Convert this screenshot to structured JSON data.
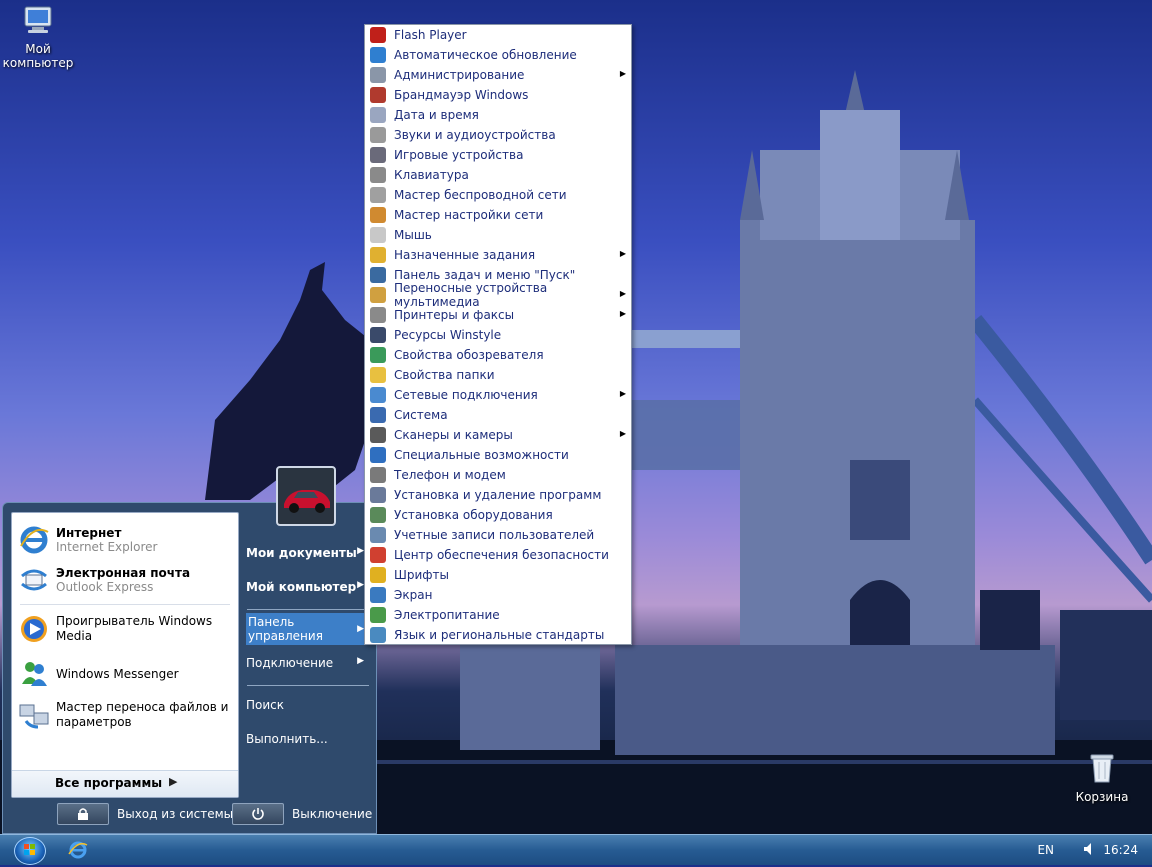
{
  "desktop": {
    "icons": [
      {
        "label_line1": "Мой",
        "label_line2": "компьютер",
        "icon": "my-computer-icon"
      },
      {
        "label_line1": "Корзина",
        "icon": "recycle-bin-icon"
      }
    ]
  },
  "start_menu": {
    "pinned": [
      {
        "title": "Интернет",
        "subtitle": "Internet Explorer",
        "icon": "internet-explorer-icon"
      },
      {
        "title": "Электронная почта",
        "subtitle": "Outlook Express",
        "icon": "outlook-express-icon"
      }
    ],
    "recent": [
      {
        "line1": "Проигрыватель Windows",
        "line2": "Media",
        "icon": "windows-media-player-icon"
      },
      {
        "line1": "Windows Messenger",
        "icon": "windows-messenger-icon"
      },
      {
        "line1": "Мастер переноса файлов и",
        "line2": "параметров",
        "icon": "files-transfer-wizard-icon"
      }
    ],
    "all_programs": "Все программы",
    "right": {
      "my_documents": "Мои документы",
      "my_computer": "Мой компьютер",
      "control_panel_line1": "Панель",
      "control_panel_line2": "управления",
      "connect": "Подключение",
      "search": "Поиск",
      "run": "Выполнить..."
    },
    "logoff": "Выход из системы",
    "shutdown": "Выключение"
  },
  "control_panel_menu": {
    "items": [
      {
        "label": "Flash Player",
        "submenu": false,
        "color": "#c0201a"
      },
      {
        "label": "Автоматическое обновление",
        "submenu": false,
        "color": "#2f7fd0"
      },
      {
        "label": "Администрирование",
        "submenu": true,
        "color": "#8a96a8"
      },
      {
        "label": "Брандмауэр Windows",
        "submenu": false,
        "color": "#b03a2e"
      },
      {
        "label": "Дата и время",
        "submenu": false,
        "color": "#9aa6c0"
      },
      {
        "label": "Звуки и аудиоустройства",
        "submenu": false,
        "color": "#9a9a9a"
      },
      {
        "label": "Игровые устройства",
        "submenu": false,
        "color": "#6a6a7a"
      },
      {
        "label": "Клавиатура",
        "submenu": false,
        "color": "#8a8a8a"
      },
      {
        "label": "Мастер беспроводной сети",
        "submenu": false,
        "color": "#a0a0a0"
      },
      {
        "label": "Мастер настройки сети",
        "submenu": false,
        "color": "#d08a30"
      },
      {
        "label": "Мышь",
        "submenu": false,
        "color": "#c8c8c8"
      },
      {
        "label": "Назначенные задания",
        "submenu": true,
        "color": "#e0b030"
      },
      {
        "label": "Панель задач и меню \"Пуск\"",
        "submenu": false,
        "color": "#3a6aa0"
      },
      {
        "label": "Переносные устройства мультимедиа",
        "submenu": true,
        "color": "#d0a040"
      },
      {
        "label": "Принтеры и факсы",
        "submenu": true,
        "color": "#8a8a8a"
      },
      {
        "label": "Ресурсы Winstyle",
        "submenu": false,
        "color": "#3a4a6a"
      },
      {
        "label": "Свойства обозревателя",
        "submenu": false,
        "color": "#3a9a5a"
      },
      {
        "label": "Свойства папки",
        "submenu": false,
        "color": "#e8c040"
      },
      {
        "label": "Сетевые подключения",
        "submenu": true,
        "color": "#4a8ad0"
      },
      {
        "label": "Система",
        "submenu": false,
        "color": "#3a6ab0"
      },
      {
        "label": "Сканеры и камеры",
        "submenu": true,
        "color": "#5a5a5a"
      },
      {
        "label": "Специальные возможности",
        "submenu": false,
        "color": "#2f6fc0"
      },
      {
        "label": "Телефон и модем",
        "submenu": false,
        "color": "#7a7a7a"
      },
      {
        "label": "Установка и удаление программ",
        "submenu": false,
        "color": "#6a7a9a"
      },
      {
        "label": "Установка оборудования",
        "submenu": false,
        "color": "#5a8a5a"
      },
      {
        "label": "Учетные записи пользователей",
        "submenu": false,
        "color": "#6a8ab0"
      },
      {
        "label": "Центр обеспечения безопасности",
        "submenu": false,
        "color": "#d04030"
      },
      {
        "label": "Шрифты",
        "submenu": false,
        "color": "#e0b020"
      },
      {
        "label": "Экран",
        "submenu": false,
        "color": "#3a7ac0"
      },
      {
        "label": "Электропитание",
        "submenu": false,
        "color": "#4a9a4a"
      },
      {
        "label": "Язык и региональные стандарты",
        "submenu": false,
        "color": "#4a8ac0"
      }
    ]
  },
  "taskbar": {
    "language": "EN",
    "clock": "16:24"
  }
}
